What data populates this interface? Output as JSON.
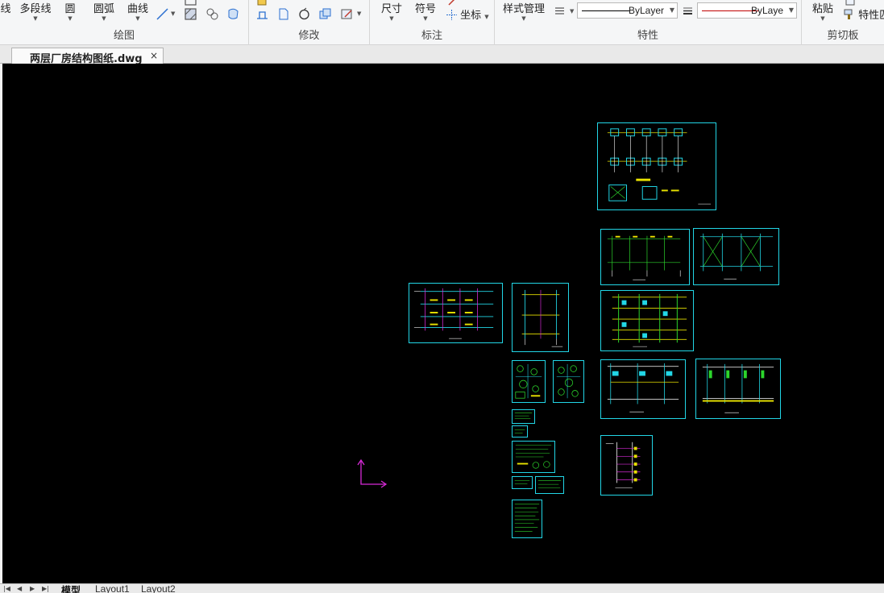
{
  "document": {
    "tab_name": "两层厂房结构图纸.dwg",
    "close_glyph": "×"
  },
  "ribbon": {
    "draw": {
      "label": "绘图",
      "items": [
        {
          "id": "line",
          "label": "线"
        },
        {
          "id": "polyline",
          "label": "多段线"
        },
        {
          "id": "circle",
          "label": "圆"
        },
        {
          "id": "arc",
          "label": "圆弧"
        },
        {
          "id": "curve",
          "label": "曲线"
        }
      ]
    },
    "modify": {
      "label": "修改"
    },
    "annotation": {
      "label": "标注",
      "dimension": "尺寸",
      "symbol": "符号",
      "coordinate": "坐标"
    },
    "properties": {
      "label": "特性",
      "style_manager": "样式管理",
      "linetype_value": "ByLayer",
      "lineweight_value": "ByLaye"
    },
    "clipboard": {
      "label": "剪切板",
      "paste": "粘贴",
      "match_properties": "特性匹"
    }
  },
  "layout_tabs": [
    "模型",
    "Layout1",
    "Layout2"
  ],
  "colors": {
    "canvas": "#000000",
    "sheet_border": "#22d6e6",
    "ucs": "#d62ad6",
    "linetype_sample": "#000000",
    "lineweight_sample": "#c00000"
  }
}
